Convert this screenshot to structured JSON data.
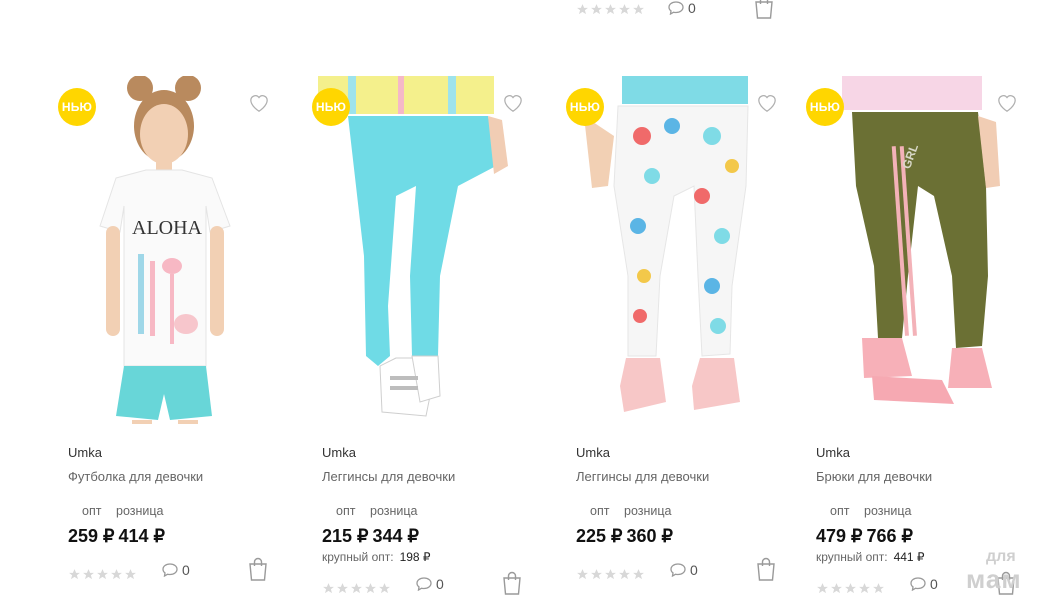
{
  "top_row": {
    "comments_count": "0"
  },
  "products": [
    {
      "badge": "НЬЮ",
      "brand": "Umka",
      "name": "Футболка для девочки",
      "price_label_opt": "опт",
      "price_label_retail": "розница",
      "price_opt": "259 ₽",
      "price_retail": "414 ₽",
      "bulk_label": "",
      "bulk_value": "",
      "comments_count": "0",
      "rating": 0
    },
    {
      "badge": "НЬЮ",
      "brand": "Umka",
      "name": "Леггинсы для девочки",
      "price_label_opt": "опт",
      "price_label_retail": "розница",
      "price_opt": "215 ₽",
      "price_retail": "344 ₽",
      "bulk_label": "крупный опт:",
      "bulk_value": "198 ₽",
      "comments_count": "0",
      "rating": 0
    },
    {
      "badge": "НЬЮ",
      "brand": "Umka",
      "name": "Леггинсы для девочки",
      "price_label_opt": "опт",
      "price_label_retail": "розница",
      "price_opt": "225 ₽",
      "price_retail": "360 ₽",
      "bulk_label": "",
      "bulk_value": "",
      "comments_count": "0",
      "rating": 0
    },
    {
      "badge": "НЬЮ",
      "brand": "Umka",
      "name": "Брюки для девочки",
      "price_label_opt": "опт",
      "price_label_retail": "розница",
      "price_opt": "479 ₽",
      "price_retail": "766 ₽",
      "bulk_label": "крупный опт:",
      "bulk_value": "441 ₽",
      "comments_count": "0",
      "rating": 0
    }
  ],
  "watermark": {
    "line1": "для",
    "line2": "мам"
  },
  "colors": {
    "badge": "#ffd600",
    "star_empty": "#d8d8d8",
    "icon": "#9a9a9a"
  },
  "icons": [
    "heart-outline-icon",
    "star-icon",
    "comment-bubble-icon",
    "shopping-bag-icon"
  ]
}
